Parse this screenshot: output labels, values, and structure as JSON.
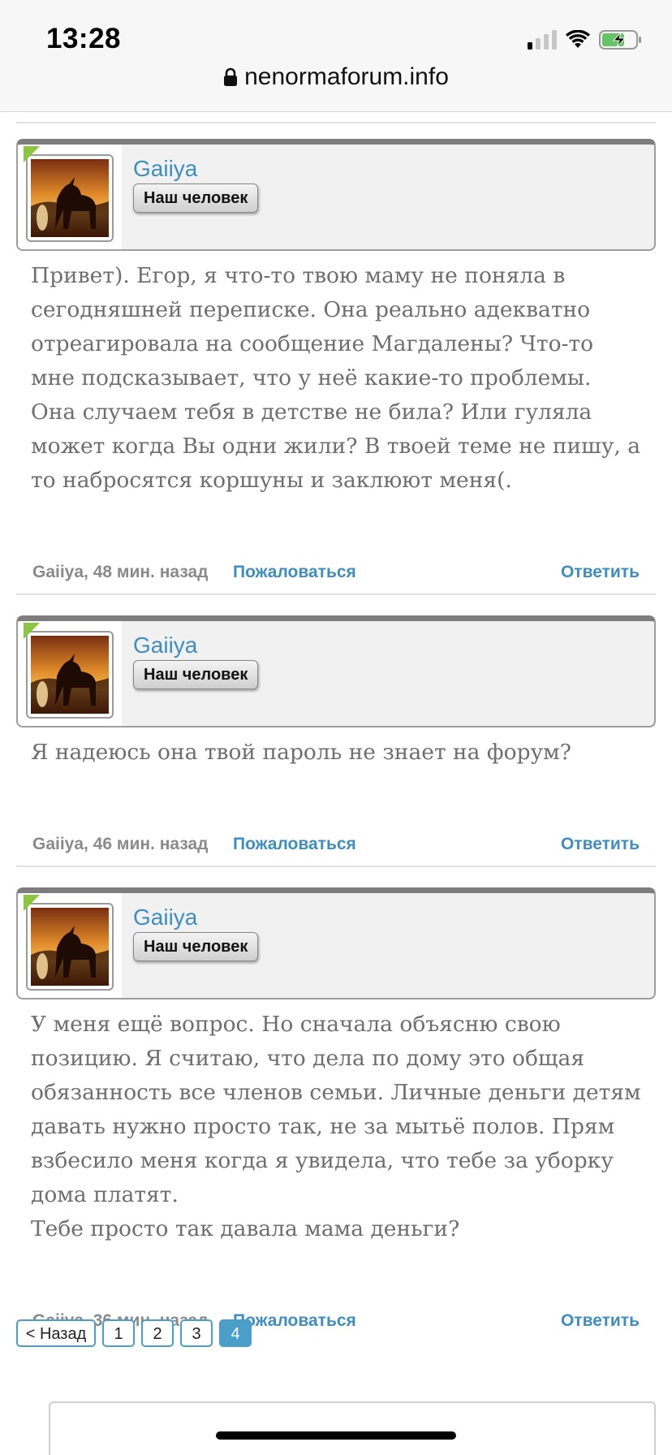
{
  "status_bar": {
    "time": "13:28",
    "battery_color": "#65c466"
  },
  "url_bar": {
    "url": "nenormaforum.info",
    "lock_icon": "lock-icon"
  },
  "colors": {
    "link": "#3f8ebf",
    "active_page": "#4a9fc9",
    "online_marker": "#8cc63f"
  },
  "posts": [
    {
      "username": "Gaiiya",
      "role": "Наш человек",
      "body": "Привет). Егор, я что-то твою маму не поняла в сегодняшней переписке. Она реально адекватно отреагировала на сообщение Магдалены? Что-то мне подсказывает, что у неё какие-то проблемы. Она случаем тебя в детстве не била? Или гуляла может когда Вы одни жили? В твоей теме не пишу, а то набросятся коршуны и заклюют меня(.",
      "meta": "Gaiiya, 48 мин. назад",
      "report": "Пожаловаться",
      "reply": "Ответить"
    },
    {
      "username": "Gaiiya",
      "role": "Наш человек",
      "body": "Я надеюсь она твой пароль не знает на форум?",
      "meta": "Gaiiya, 46 мин. назад",
      "report": "Пожаловаться",
      "reply": "Ответить"
    },
    {
      "username": "Gaiiya",
      "role": "Наш человек",
      "body": "У меня ещё вопрос. Но сначала объясню свою позицию. Я считаю, что дела по дому это общая обязанность все членов семьи. Личные деньги детям давать нужно просто так, не за мытьё полов. Прям взбесило меня когда я увидела, что тебе за уборку дома платят.\nТебе просто так давала мама деньги?",
      "meta": "Gaiiya, 36 мин. назад",
      "report": "Пожаловаться",
      "reply": "Ответить"
    }
  ],
  "pagination": {
    "prev": "< Назад",
    "pages": [
      "1",
      "2",
      "3",
      "4"
    ],
    "current": "4"
  }
}
